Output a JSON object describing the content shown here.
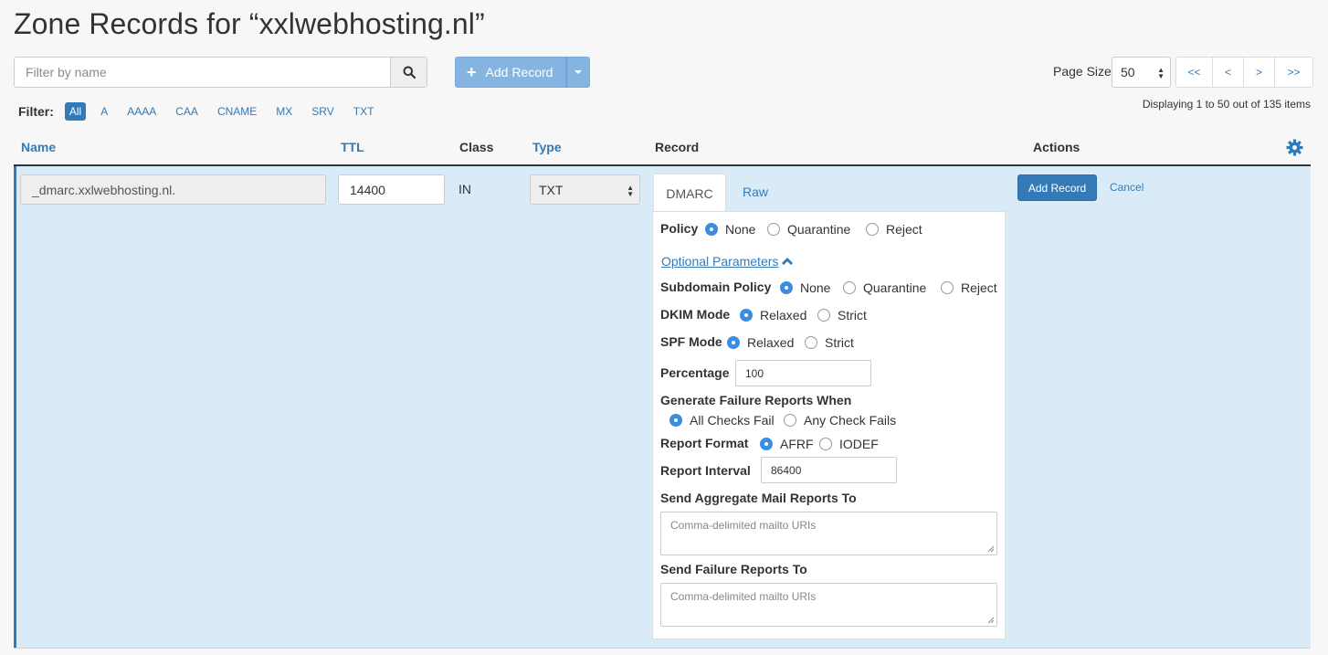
{
  "page": {
    "title": "Zone Records for “xxlwebhosting.nl”"
  },
  "search": {
    "placeholder": "Filter by name",
    "icon": "search-icon"
  },
  "toolbar": {
    "add_record_label": "Add Record",
    "add_icon": "plus-icon",
    "dropdown_icon": "caret-down-icon"
  },
  "filter": {
    "label": "Filter:",
    "options": [
      "All",
      "A",
      "AAAA",
      "CAA",
      "CNAME",
      "MX",
      "SRV",
      "TXT"
    ],
    "active": "All"
  },
  "pagination": {
    "page_size_label": "Page Size",
    "page_size": "50",
    "buttons": [
      "<<",
      "<",
      ">",
      ">>"
    ],
    "display_text": "Displaying 1 to 50 out of 135 items"
  },
  "table": {
    "columns": {
      "name": "Name",
      "ttl": "TTL",
      "class": "Class",
      "type": "Type",
      "record": "Record",
      "actions": "Actions"
    },
    "settings_icon": "gear-icon"
  },
  "edit_row": {
    "name": "_dmarc.xxlwebhosting.nl.",
    "ttl": "14400",
    "class": "IN",
    "type": "TXT",
    "tabs": {
      "dmarc": "DMARC",
      "raw": "Raw"
    },
    "policy": {
      "label": "Policy",
      "options": [
        "None",
        "Quarantine",
        "Reject"
      ],
      "selected": "None"
    },
    "optional_params_label": "Optional Parameters",
    "subdomain_policy": {
      "label": "Subdomain Policy",
      "options": [
        "None",
        "Quarantine",
        "Reject"
      ],
      "selected": "None"
    },
    "dkim_mode": {
      "label": "DKIM Mode",
      "options": [
        "Relaxed",
        "Strict"
      ],
      "selected": "Relaxed"
    },
    "spf_mode": {
      "label": "SPF Mode",
      "options": [
        "Relaxed",
        "Strict"
      ],
      "selected": "Relaxed"
    },
    "percentage": {
      "label": "Percentage",
      "value": "100"
    },
    "failure_reports": {
      "label": "Generate Failure Reports When",
      "options": [
        "All Checks Fail",
        "Any Check Fails"
      ],
      "selected": "All Checks Fail"
    },
    "report_format": {
      "label": "Report Format",
      "options": [
        "AFRF",
        "IODEF"
      ],
      "selected": "AFRF"
    },
    "report_interval": {
      "label": "Report Interval",
      "value": "86400"
    },
    "aggregate_to": {
      "label": "Send Aggregate Mail Reports To",
      "placeholder": "Comma-delimited mailto URIs"
    },
    "failure_to": {
      "label": "Send Failure Reports To",
      "placeholder": "Comma-delimited mailto URIs"
    },
    "actions": {
      "add": "Add Record",
      "cancel": "Cancel"
    }
  },
  "colors": {
    "accent": "#337ab7",
    "row_bg": "#d9ebf7",
    "radio_on": "#3b8de0"
  }
}
